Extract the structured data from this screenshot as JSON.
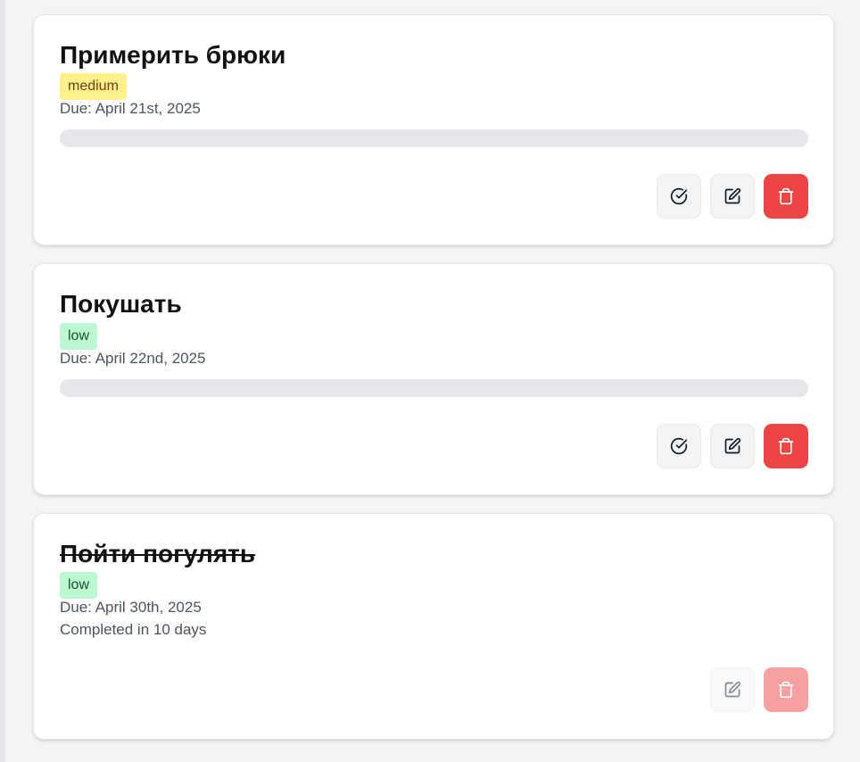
{
  "colors": {
    "page_background": "#f3f4f6",
    "card_background": "#ffffff",
    "badge_medium": "#fef08a",
    "badge_low": "#bbf7d0",
    "progress_track": "#e5e7eb",
    "delete_button": "#ef4444"
  },
  "icons": {
    "complete": "check-circle-icon",
    "edit": "edit-icon",
    "delete": "trash-icon"
  },
  "tasks": [
    {
      "title": "Примерить брюки",
      "priority": "medium",
      "due": "Due: April 21st, 2025",
      "progress": 0,
      "completed": false
    },
    {
      "title": "Покушать",
      "priority": "low",
      "due": "Due: April 22nd, 2025",
      "progress": 0,
      "completed": false
    },
    {
      "title": "Пойти погулять",
      "priority": "low",
      "due": "Due: April 30th, 2025",
      "completed_text": "Completed in 10 days",
      "completed": true
    }
  ]
}
